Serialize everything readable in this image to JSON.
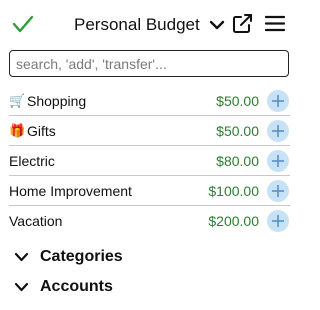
{
  "header": {
    "title": "Personal Budget"
  },
  "search": {
    "placeholder": "search, 'add', 'transfer'...",
    "value": ""
  },
  "budget_items": [
    {
      "emoji": "🛒",
      "name": "Shopping",
      "amount": "$50.00"
    },
    {
      "emoji": "🎁",
      "name": "Gifts",
      "amount": "$50.00"
    },
    {
      "emoji": "",
      "name": "Electric",
      "amount": "$80.00"
    },
    {
      "emoji": "",
      "name": "Home Improvement",
      "amount": "$100.00"
    },
    {
      "emoji": "",
      "name": "Vacation",
      "amount": "$200.00"
    }
  ],
  "sections": {
    "categories": "Categories",
    "accounts": "Accounts"
  },
  "colors": {
    "check": "#2e9e3a",
    "amount": "#2e7d32",
    "add_bg": "#c7e1f5",
    "add_fg": "#5b8fc4"
  },
  "icons": {
    "check": "check-icon",
    "title_dropdown": "chevron-down-icon",
    "external": "external-link-icon",
    "menu": "hamburger-menu-icon",
    "add": "plus-icon"
  }
}
